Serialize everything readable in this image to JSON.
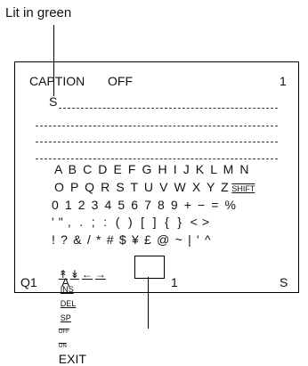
{
  "callout": {
    "top_label": "Lit in green"
  },
  "screen": {
    "header": {
      "mode": "CAPTION",
      "state": "OFF",
      "page": "1"
    },
    "cursor_line": "S_____________________",
    "keyboard_rows": [
      "A B C D E F G H I J K L M N",
      "O P Q R S T U V W X Y Z",
      "0 1 2 3 4 5 6 7 8 9 + − = %",
      "' \" ,  .  ;  :  (  )  [  ]  {  }  < >",
      "! ? & / * # $ ¥ £ @ ~ | ' ^"
    ],
    "shift_key": "SHIFT",
    "controls": {
      "arrows": [
        "↟",
        "↡",
        "←",
        "→"
      ],
      "ins": "INS",
      "del": "DEL",
      "sp": "SP",
      "off": "OFF",
      "on": "ON",
      "exit": "EXIT"
    },
    "footer": {
      "channel": "Q1",
      "char": "A",
      "num": "1",
      "mode": "S"
    }
  }
}
